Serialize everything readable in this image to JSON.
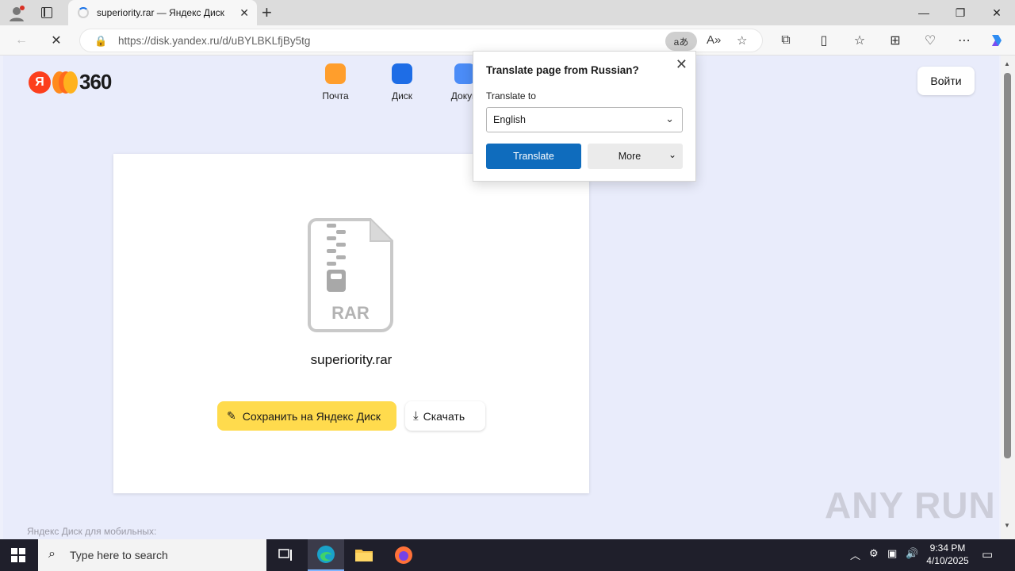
{
  "browser": {
    "tab_title": "superiority.rar — Яндекс Диск",
    "url": "https://disk.yandex.ru/d/uBYLBKLfjBy5tg",
    "translate_badge": "aあ"
  },
  "header": {
    "logo_ya": "Я",
    "logo_num": "360",
    "services": [
      {
        "label": "Почта",
        "icon": "mail-icon",
        "color": "#ff9e2c"
      },
      {
        "label": "Диск",
        "icon": "disk-icon",
        "color": "#1e6de6"
      },
      {
        "label": "Докум",
        "icon": "docs-icon",
        "color": "#4b8cf7"
      }
    ],
    "login_label": "Войти"
  },
  "file": {
    "type_label": "RAR",
    "name": "superiority.rar",
    "save_label": "Сохранить на Яндекс Диск",
    "download_label": "Скачать"
  },
  "footer": {
    "mobile_text": "Яндекс Диск для мобильных:"
  },
  "watermark": "ANY RUN",
  "translate_popup": {
    "title": "Translate page from Russian?",
    "target_label": "Translate to",
    "selected_language": "English",
    "translate_label": "Translate",
    "more_label": "More"
  },
  "taskbar": {
    "search_placeholder": "Type here to search",
    "time": "9:34 PM",
    "date": "4/10/2025"
  },
  "colors": {
    "accent_blue": "#0f6cbd",
    "yandex_yellow": "#ffdb4d",
    "yandex_red": "#fc3f1d"
  }
}
